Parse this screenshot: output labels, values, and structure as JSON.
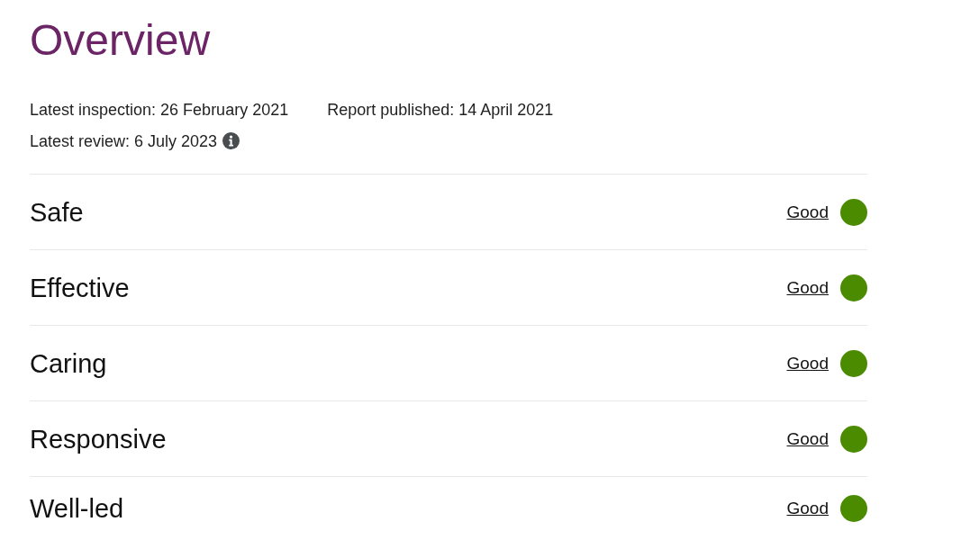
{
  "heading": "Overview",
  "dates": {
    "latest_inspection": "Latest inspection: 26 February 2021",
    "report_published": "Report published: 14 April 2021",
    "latest_review": "Latest review: 6 July 2023"
  },
  "ratings": [
    {
      "category": "Safe",
      "rating": "Good",
      "color": "#4b8b00"
    },
    {
      "category": "Effective",
      "rating": "Good",
      "color": "#4b8b00"
    },
    {
      "category": "Caring",
      "rating": "Good",
      "color": "#4b8b00"
    },
    {
      "category": "Responsive",
      "rating": "Good",
      "color": "#4b8b00"
    },
    {
      "category": "Well-led",
      "rating": "Good",
      "color": "#4b8b00"
    }
  ]
}
